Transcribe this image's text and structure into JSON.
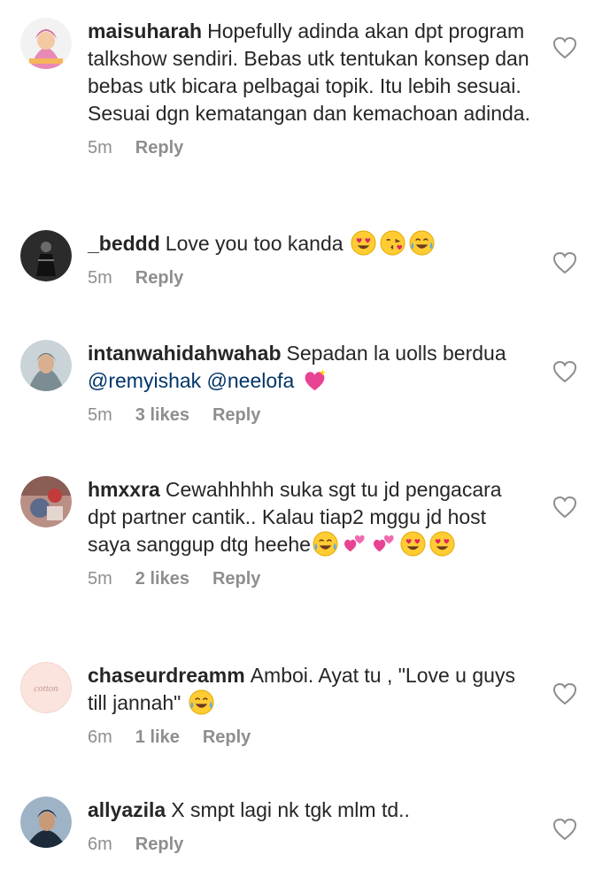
{
  "comments": [
    {
      "username": "maisuharah",
      "segments": [
        {
          "t": "text",
          "v": "Hopefully adinda akan dpt program talkshow sendiri. Bebas utk tentukan konsep dan bebas utk bicara pelbagai topik. Itu lebih sesuai. Sesuai dgn kematangan dan kemachoan adinda."
        }
      ],
      "time": "5m",
      "likes": "",
      "reply_label": "Reply",
      "avatar": "avatar-hijab-cartoon"
    },
    {
      "username": "_beddd",
      "segments": [
        {
          "t": "text",
          "v": "Love you too kanda "
        },
        {
          "t": "emoji",
          "v": "heart-eyes-emoji"
        },
        {
          "t": "emoji",
          "v": "kissing-heart-emoji"
        },
        {
          "t": "emoji",
          "v": "tears-of-joy-emoji"
        }
      ],
      "time": "5m",
      "likes": "",
      "reply_label": "Reply",
      "avatar": "avatar-dark-figure"
    },
    {
      "username": "intanwahidahwahab",
      "segments": [
        {
          "t": "text",
          "v": "Sepadan la uolls berdua "
        },
        {
          "t": "mention",
          "v": "@remyishak"
        },
        {
          "t": "text",
          "v": " "
        },
        {
          "t": "mention",
          "v": "@neelofa"
        },
        {
          "t": "text",
          "v": " "
        },
        {
          "t": "emoji",
          "v": "sparkling-heart-emoji"
        }
      ],
      "time": "5m",
      "likes": "3 likes",
      "reply_label": "Reply",
      "avatar": "avatar-hijab-photo"
    },
    {
      "username": "hmxxra",
      "segments": [
        {
          "t": "text",
          "v": "Cewahhhhh suka sgt tu jd pengacara dpt partner cantik.. Kalau tiap2 mggu jd host saya sanggup dtg heehe"
        },
        {
          "t": "emoji",
          "v": "tears-of-joy-emoji"
        },
        {
          "t": "emoji",
          "v": "two-hearts-emoji"
        },
        {
          "t": "emoji",
          "v": "two-hearts-emoji"
        },
        {
          "t": "emoji",
          "v": "heart-eyes-emoji"
        },
        {
          "t": "emoji",
          "v": "heart-eyes-emoji"
        }
      ],
      "time": "5m",
      "likes": "2 likes",
      "reply_label": "Reply",
      "avatar": "avatar-globe-photo"
    },
    {
      "username": "chaseurdreamm",
      "segments": [
        {
          "t": "text",
          "v": "Amboi. Ayat tu , \"Love u guys till jannah\" "
        },
        {
          "t": "emoji",
          "v": "tears-of-joy-emoji"
        }
      ],
      "time": "6m",
      "likes": "1 like",
      "reply_label": "Reply",
      "avatar": "avatar-cotton-logo",
      "avatar_text": "cotton"
    },
    {
      "username": "allyazila",
      "segments": [
        {
          "t": "text",
          "v": "X smpt lagi nk tgk mlm td.."
        }
      ],
      "time": "6m",
      "likes": "",
      "reply_label": "Reply",
      "avatar": "avatar-selfie-photo"
    }
  ],
  "colors": {
    "text": "#262626",
    "meta": "#8e8e8e",
    "mention": "#003569",
    "background": "#ffffff"
  }
}
